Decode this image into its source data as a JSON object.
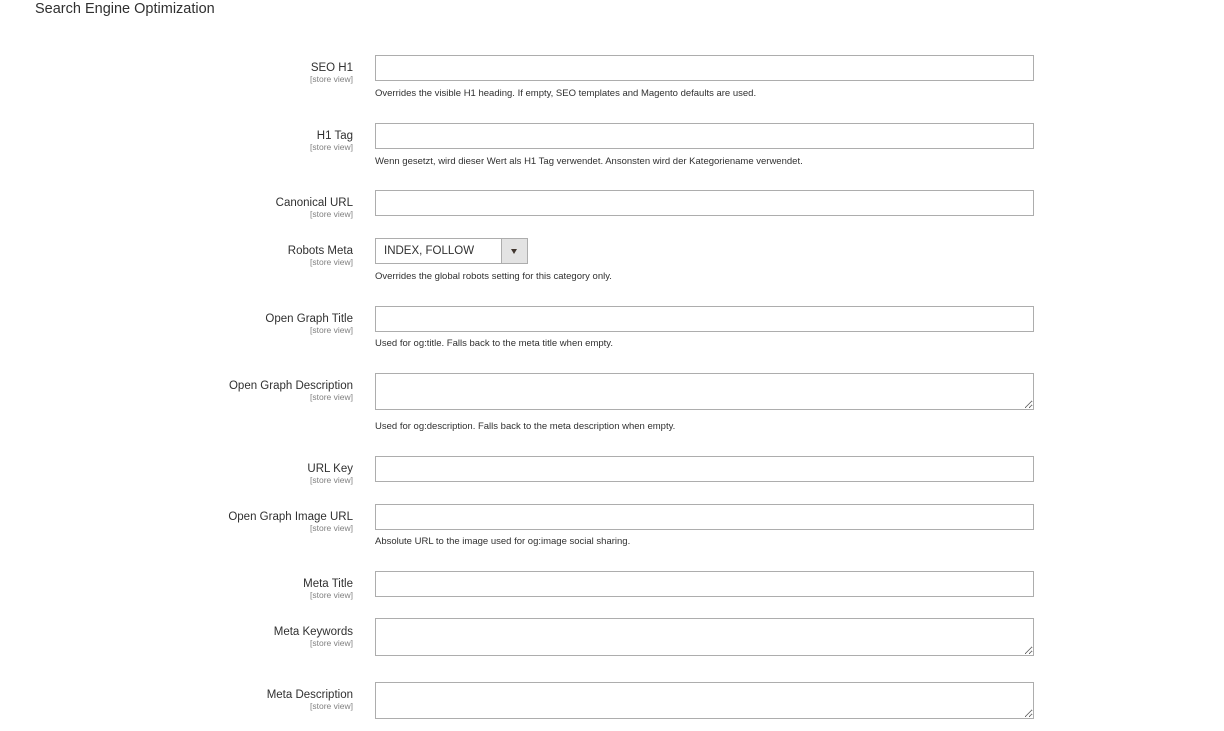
{
  "section": {
    "title": "Search Engine Optimization"
  },
  "fields": [
    {
      "key": "seo_h1",
      "label": "SEO H1",
      "scope": "[store view]",
      "value": "",
      "note": "Overrides the visible H1 heading. If empty, SEO templates and Magento defaults are used."
    },
    {
      "key": "h1_tag",
      "label": "H1 Tag",
      "scope": "[store view]",
      "value": "",
      "note": "Wenn gesetzt, wird dieser Wert als H1 Tag verwendet. Ansonsten wird der Kategoriename verwendet."
    },
    {
      "key": "canonical_url",
      "label": "Canonical URL",
      "scope": "[store view]",
      "value": ""
    },
    {
      "key": "robots_meta",
      "label": "Robots Meta",
      "scope": "[store view]",
      "selected": "INDEX, FOLLOW",
      "note": "Overrides the global robots setting for this category only."
    },
    {
      "key": "og_title",
      "label": "Open Graph Title",
      "scope": "[store view]",
      "value": "",
      "note": "Used for og:title. Falls back to the meta title when empty."
    },
    {
      "key": "og_description",
      "label": "Open Graph Description",
      "scope": "[store view]",
      "value": "",
      "note": "Used for og:description. Falls back to the meta description when empty."
    },
    {
      "key": "url_key",
      "label": "URL Key",
      "scope": "[store view]",
      "value": ""
    },
    {
      "key": "og_image_url",
      "label": "Open Graph Image URL",
      "scope": "[store view]",
      "value": "",
      "note": "Absolute URL to the image used for og:image social sharing."
    },
    {
      "key": "meta_title",
      "label": "Meta Title",
      "scope": "[store view]",
      "value": ""
    },
    {
      "key": "meta_keywords",
      "label": "Meta Keywords",
      "scope": "[store view]",
      "value": ""
    },
    {
      "key": "meta_description",
      "label": "Meta Description",
      "scope": "[store view]",
      "value": ""
    }
  ],
  "icons": {
    "select_arrow": "triangle-down-icon"
  }
}
